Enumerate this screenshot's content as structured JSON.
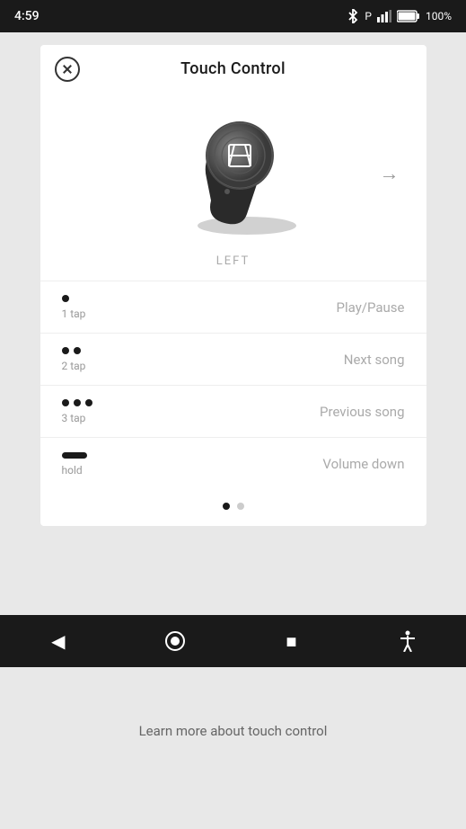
{
  "statusBar": {
    "time": "4:59",
    "battery": "100%"
  },
  "header": {
    "title": "Touch Control",
    "closeLabel": "close"
  },
  "earphone": {
    "side": "LEFT",
    "arrowLabel": "→"
  },
  "controls": [
    {
      "dots": 1,
      "tapType": "tap",
      "tapLabel": "1 tap",
      "action": "Play/Pause"
    },
    {
      "dots": 2,
      "tapType": "tap",
      "tapLabel": "2 tap",
      "action": "Next song"
    },
    {
      "dots": 3,
      "tapType": "tap",
      "tapLabel": "3 tap",
      "action": "Previous song"
    },
    {
      "dots": 0,
      "tapType": "hold",
      "tapLabel": "hold",
      "action": "Volume down"
    }
  ],
  "pagination": {
    "total": 2,
    "active": 0
  },
  "bottomNav": {
    "back": "◀",
    "home": "⬤",
    "recents": "■",
    "accessibility": "♿"
  },
  "learnMore": "Learn more about touch control"
}
